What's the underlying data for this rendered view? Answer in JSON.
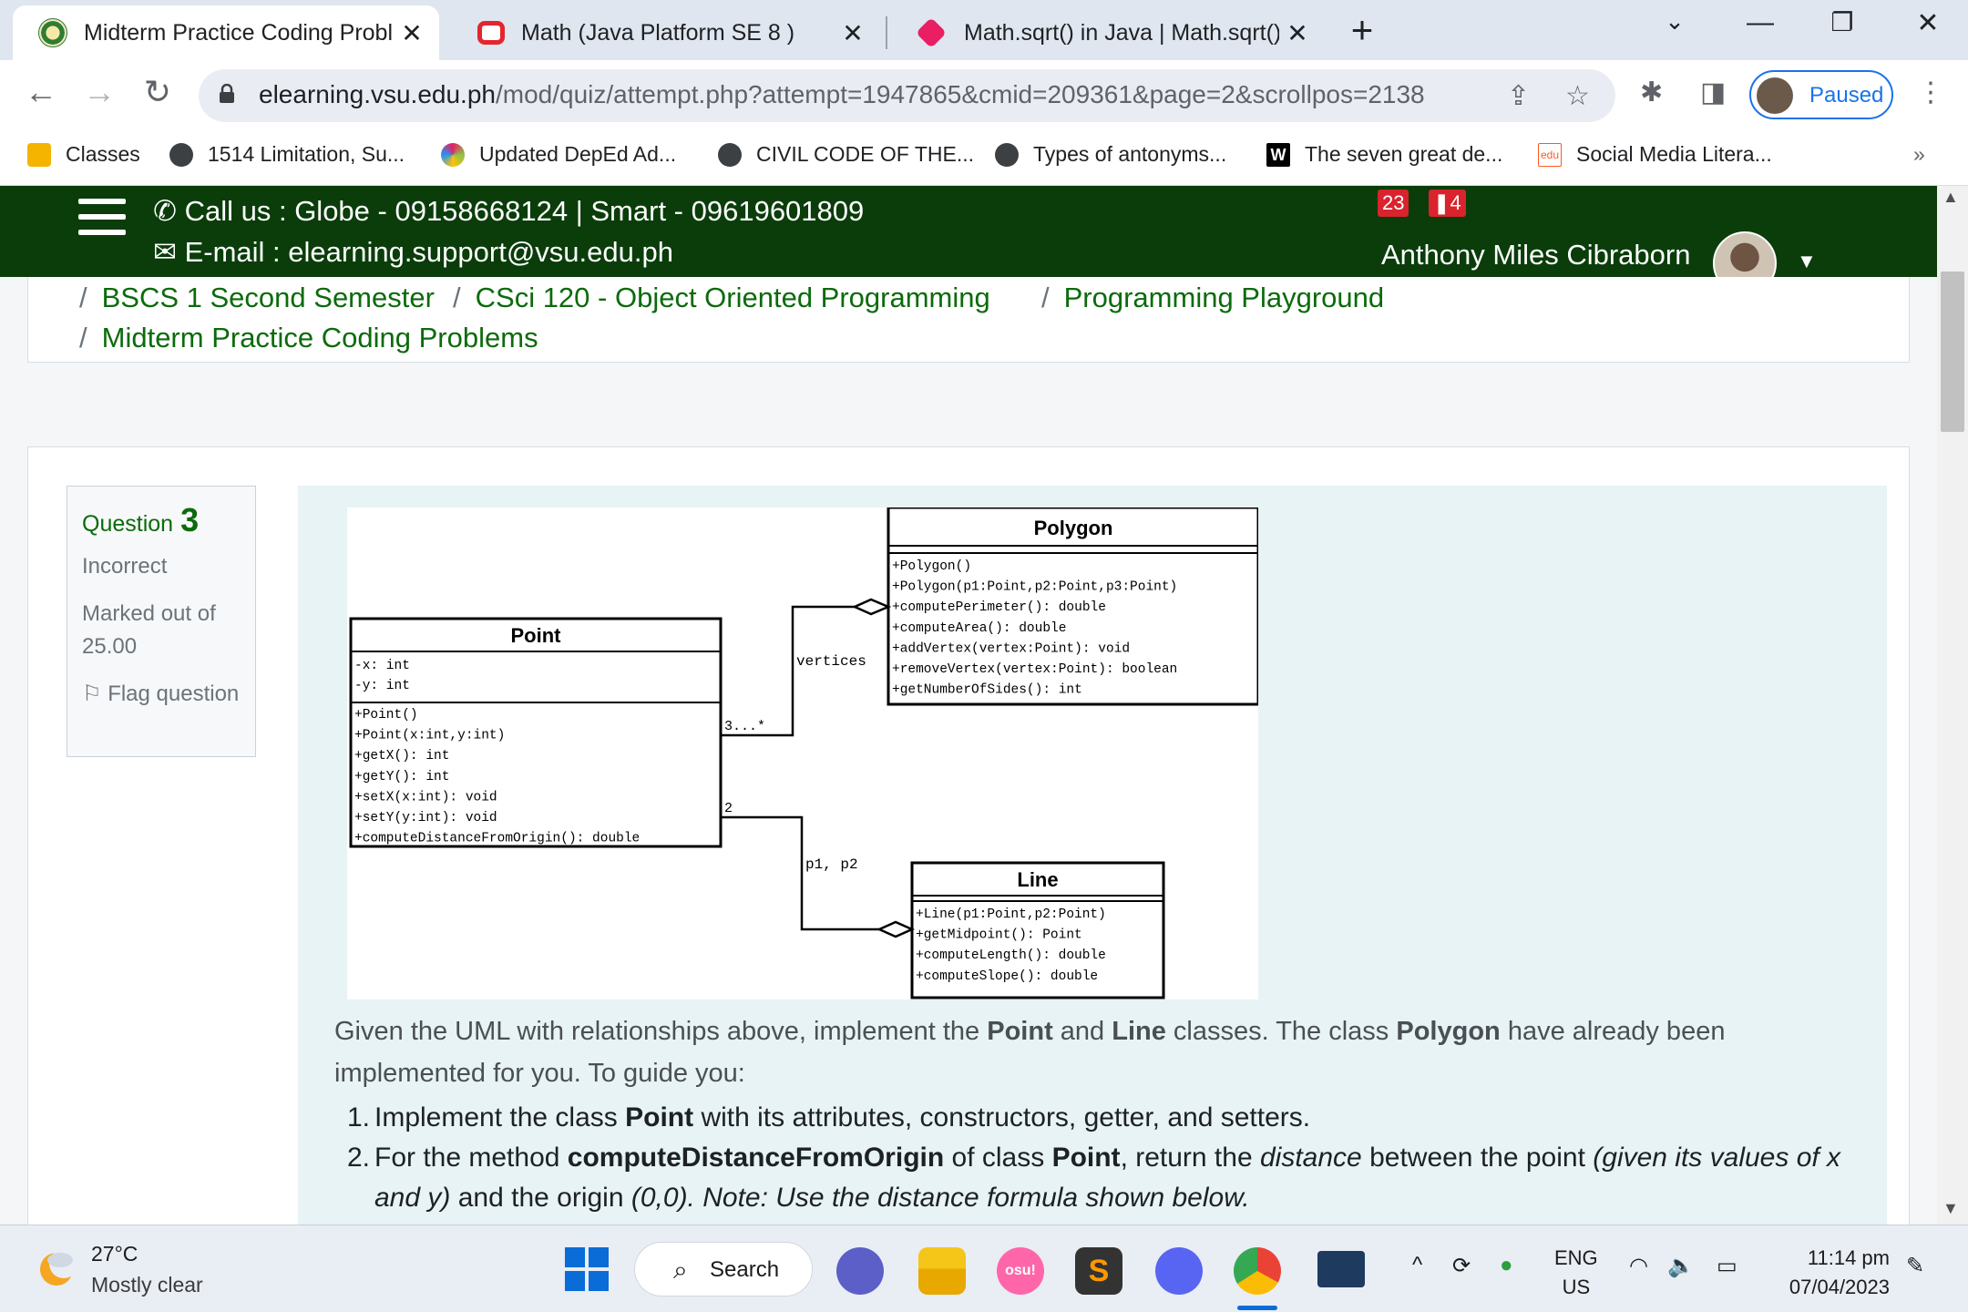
{
  "browser": {
    "tabs": [
      {
        "title": "Midterm Practice Coding Problen",
        "favicon": "vsu-logo-icon",
        "active": true
      },
      {
        "title": "Math (Java Platform SE 8 )",
        "favicon": "oracle-icon",
        "active": false
      },
      {
        "title": "Math.sqrt() in Java | Math.sqrt() M",
        "favicon": "javatpoint-icon",
        "active": false
      }
    ],
    "url_host": "elearning.vsu.edu.ph",
    "url_path": "/mod/quiz/attempt.php?attempt=1947865&cmid=209361&page=2&scrollpos=2138",
    "profile_status": "Paused"
  },
  "bookmarks": [
    {
      "label": "Classes",
      "icon": "classroom-icon",
      "color": "#f4b400"
    },
    {
      "label": "1514 Limitation, Su...",
      "icon": "globe-icon",
      "color": "#444"
    },
    {
      "label": "Updated DepEd Ad...",
      "icon": "deped-icon",
      "color": "#8bc34a"
    },
    {
      "label": "CIVIL CODE OF THE...",
      "icon": "globe-icon",
      "color": "#444"
    },
    {
      "label": "Types of antonyms...",
      "icon": "globe-icon",
      "color": "#444"
    },
    {
      "label": "The seven great de...",
      "icon": "w-icon",
      "color": "#000"
    },
    {
      "label": "Social Media Litera...",
      "icon": "edu-icon",
      "color": "#ff5722"
    }
  ],
  "site_header": {
    "call": "Call us : Globe - 09158668124 | Smart - 09619601809",
    "email": "E-mail : elearning.support@vsu.edu.ph",
    "badge_notifications": "23",
    "badge_messages": "4",
    "user_name": "Anthony Miles Cibraborn"
  },
  "breadcrumb": [
    "BSCS 1 Second Semester",
    "CSci 120 - Object Oriented Programming",
    "Programming Playground",
    "Midterm Practice Coding Problems"
  ],
  "question": {
    "label": "Question",
    "number": "3",
    "state": "Incorrect",
    "marked": "Marked out of",
    "marks": "25.00",
    "flag": "Flag question"
  },
  "uml": {
    "point": {
      "name": "Point",
      "attributes": [
        "-x: int",
        "-y: int"
      ],
      "methods": [
        "+Point()",
        "+Point(x:int,y:int)",
        "+getX(): int",
        "+getY(): int",
        "+setX(x:int): void",
        "+setY(y:int): void",
        "+computeDistanceFromOrigin(): double"
      ]
    },
    "polygon": {
      "name": "Polygon",
      "methods": [
        "+Polygon()",
        "+Polygon(p1:Point,p2:Point,p3:Point)",
        "+computePerimeter(): double",
        "+computeArea(): double",
        "+addVertex(vertex:Point): void",
        "+removeVertex(vertex:Point): boolean",
        "+getNumberOfSides(): int"
      ]
    },
    "line": {
      "name": "Line",
      "methods": [
        "+Line(p1:Point,p2:Point)",
        "+getMidpoint(): Point",
        "+computeLength(): double",
        "+computeSlope(): double"
      ]
    },
    "rel_polygon_mult": "3...*",
    "rel_polygon_role": "vertices",
    "rel_line_mult": "2",
    "rel_line_role": "p1, p2"
  },
  "text": {
    "intro_a": "Given the UML with relationships above, implement the ",
    "intro_point": "Point",
    "intro_b": " and ",
    "intro_line": "Line",
    "intro_c": " classes. The class ",
    "intro_polygon": "Polygon",
    "intro_d": " have already been implemented for you. To guide you:",
    "item1_num": "1.",
    "item1_a": "Implement the class ",
    "item1_b": "Point",
    "item1_c": " with its attributes, constructors, getter, and setters.",
    "item2_num": "2.",
    "item2_a": "For the method ",
    "item2_b": "computeDistanceFromOrigin",
    "item2_c": " of class ",
    "item2_d": "Point",
    "item2_e": ", return the ",
    "item2_f": "distance",
    "item2_g": " between the point ",
    "item2_h": "(given its values of x and y)",
    "item2_i": " and the origin ",
    "item2_j": "(0,0). Note: Use the distance formula shown below."
  },
  "taskbar": {
    "temperature": "27°C",
    "condition": "Mostly clear",
    "search": "Search",
    "lang1": "ENG",
    "lang2": "US",
    "time": "11:14 pm",
    "date": "07/04/2023"
  },
  "colors": {
    "header_green": "#0a3d0a",
    "link_green": "#0b6b0b",
    "question_bg": "#e7f3f5"
  }
}
